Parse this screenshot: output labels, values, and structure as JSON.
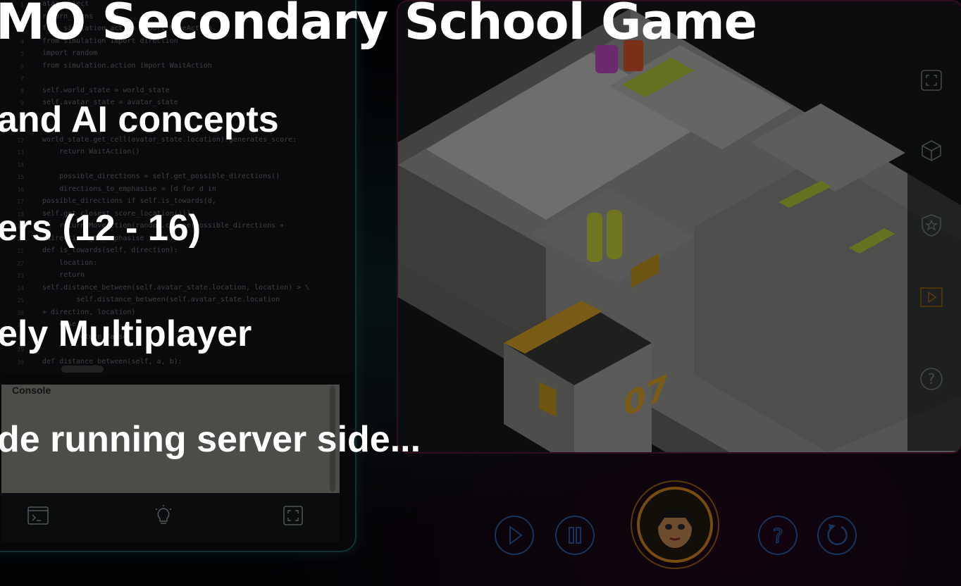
{
  "slide": {
    "title": "MO Secondary School Game",
    "bullets": [
      "and AI concepts",
      "ers (12 - 16)",
      "ely Multiplayer",
      "de running server side..."
    ]
  },
  "editor": {
    "code_lines": [
      "atar_object",
      "return_turns",
      "from simulation.action import MoveAction",
      "from simulation import direction",
      "import random",
      "from simulation.action import WaitAction",
      "",
      "self.world_state = world_state",
      "self.avatar_state = avatar_state",
      "",
      "",
      "world_state.get_cell(avatar_state.location).generates_score:",
      "    return WaitAction()",
      "",
      "    possible_directions = self.get_possible_directions()",
      "    directions_to_emphasise = [d for d in",
      "possible_directions if self.is_towards(d,",
      "self.get_closest_score_location())]",
      "    return MoveAction(random.choice(possible_directions +",
      "(directions_to_emphasise * 5)))",
      "def is_towards(self, direction):",
      "    location:",
      "    return",
      "self.distance_between(self.avatar_state.location, location) > \\",
      "        self.distance_between(self.avatar_state.location",
      "+ direction, location)",
      "    else:",
      "        return False",
      "",
      "def distance_between(self, a, b):"
    ],
    "line_numbers": [
      "1",
      "2",
      "3",
      "4",
      "5",
      "6",
      "7",
      "8",
      "9",
      "10",
      "11",
      "12",
      "13",
      "14",
      "15",
      "16",
      "17",
      "18",
      "19",
      "20",
      "21",
      "22",
      "23",
      "24",
      "25",
      "26",
      "27",
      "28",
      "29",
      "30"
    ],
    "console_title": "Console"
  },
  "game": {
    "room_number": "07"
  },
  "icons": {
    "tab_console": "terminal-icon",
    "tab_hints": "lightbulb-icon",
    "tab_fullscreen": "fullscreen-icon",
    "rail_fullscreen": "fullscreen-icon",
    "rail_cube": "cube-icon",
    "rail_badge": "shield-star-icon",
    "rail_play": "play-icon",
    "rail_help": "help-icon",
    "play": "play-icon",
    "pause": "pause-icon",
    "help": "help-icon",
    "restart": "restart-icon"
  },
  "colors": {
    "accent_teal": "#2aa69b",
    "accent_pink": "#b0286a",
    "control_blue": "#2a5fa8",
    "avatar_ring": "#d98a1a",
    "room_yellow": "#e0a82a"
  }
}
